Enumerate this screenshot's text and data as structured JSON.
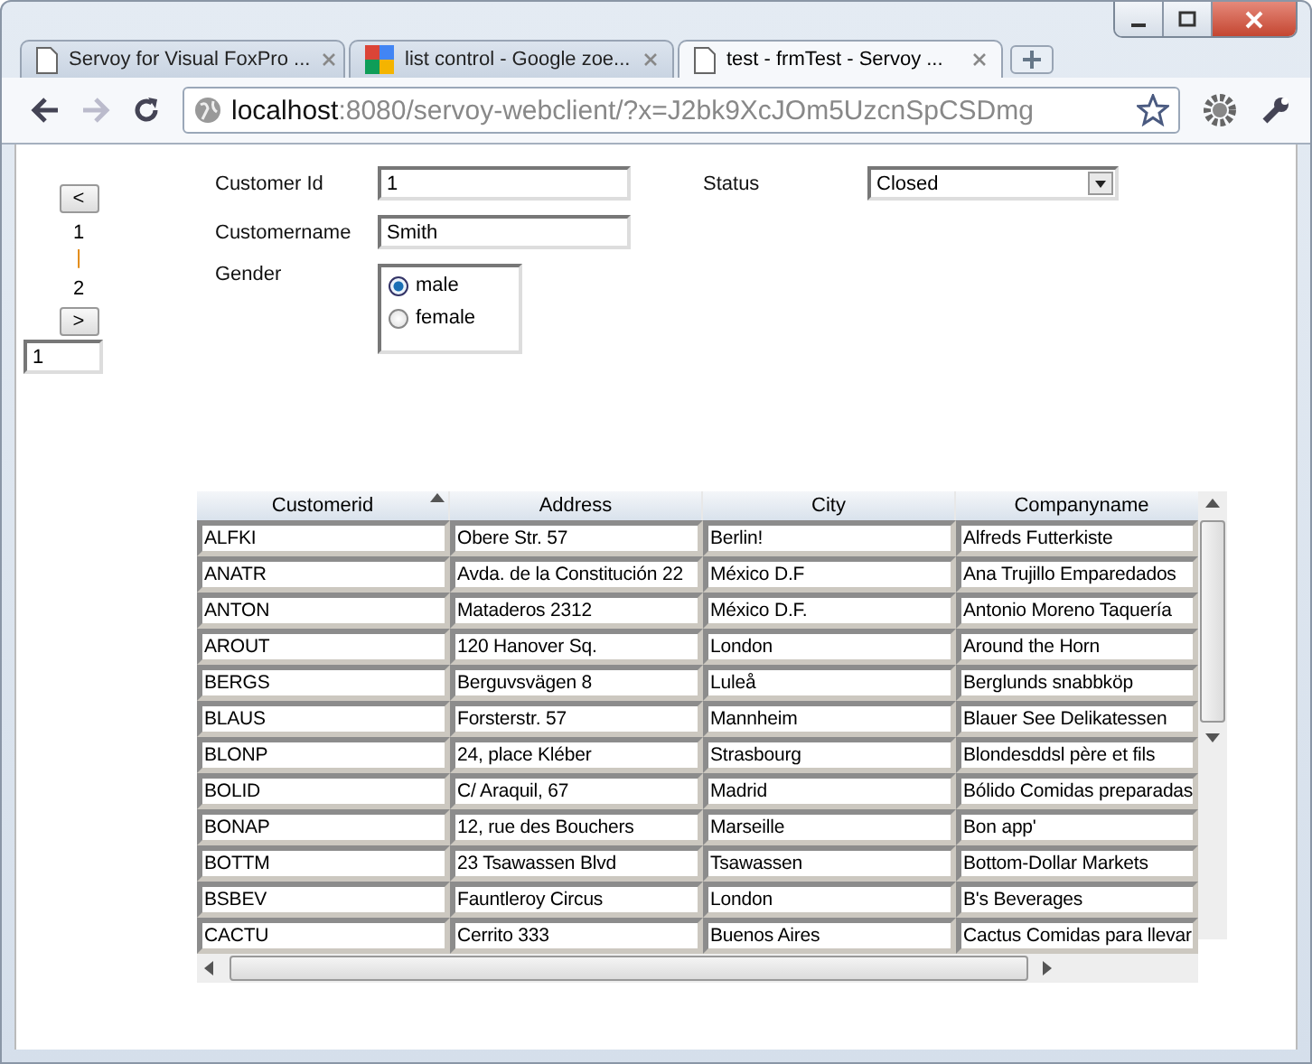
{
  "browser": {
    "tabs": [
      {
        "title": "Servoy for Visual FoxPro ...",
        "selected": false
      },
      {
        "title": "list control - Google zoe...",
        "selected": false
      },
      {
        "title": "test - frmTest - Servoy ...",
        "selected": true
      }
    ],
    "url": {
      "host": "localhost",
      "rest": ":8080/servoy-webclient/?x=J2bk9XcJOm5UzcnSpCSDmg"
    }
  },
  "navigator": {
    "prev": "<",
    "first_page": "1",
    "separator": "|",
    "second_page": "2",
    "next": ">",
    "page_field": "1"
  },
  "form": {
    "customer_id": {
      "label": "Customer Id",
      "value": "1"
    },
    "customername": {
      "label": "Customername",
      "value": "Smith"
    },
    "gender": {
      "label": "Gender",
      "options": [
        {
          "label": "male",
          "selected": true
        },
        {
          "label": "female",
          "selected": false
        }
      ]
    },
    "status": {
      "label": "Status",
      "value": "Closed"
    }
  },
  "table": {
    "columns": [
      {
        "label": "Customerid",
        "sorted": true
      },
      {
        "label": "Address",
        "sorted": false
      },
      {
        "label": "City",
        "sorted": false
      },
      {
        "label": "Companyname",
        "sorted": false
      }
    ],
    "rows": [
      [
        "ALFKI",
        "Obere Str. 57",
        "Berlin!",
        "Alfreds Futterkiste"
      ],
      [
        "ANATR",
        "Avda. de la Constitución 22",
        "México D.F",
        "Ana Trujillo Emparedados"
      ],
      [
        "ANTON",
        "Mataderos 2312",
        "México D.F.",
        "Antonio Moreno Taquería"
      ],
      [
        "AROUT",
        "120 Hanover Sq.",
        "London",
        "Around the Horn"
      ],
      [
        "BERGS",
        "Berguvsvägen 8",
        "Luleå",
        "Berglunds snabbköp"
      ],
      [
        "BLAUS",
        "Forsterstr. 57",
        "Mannheim",
        "Blauer See Delikatessen"
      ],
      [
        "BLONP",
        "24, place Kléber",
        "Strasbourg",
        "Blondesddsl père et fils"
      ],
      [
        "BOLID",
        "C/ Araquil, 67",
        "Madrid",
        "Bólido Comidas preparadas"
      ],
      [
        "BONAP",
        "12, rue des Bouchers",
        "Marseille",
        "Bon app'"
      ],
      [
        "BOTTM",
        "23 Tsawassen Blvd",
        "Tsawassen",
        "Bottom-Dollar Markets"
      ],
      [
        "BSBEV",
        "Fauntleroy Circus",
        "London",
        "B's Beverages"
      ],
      [
        "CACTU",
        "Cerrito 333",
        "Buenos Aires",
        "Cactus Comidas para llevar"
      ]
    ]
  }
}
